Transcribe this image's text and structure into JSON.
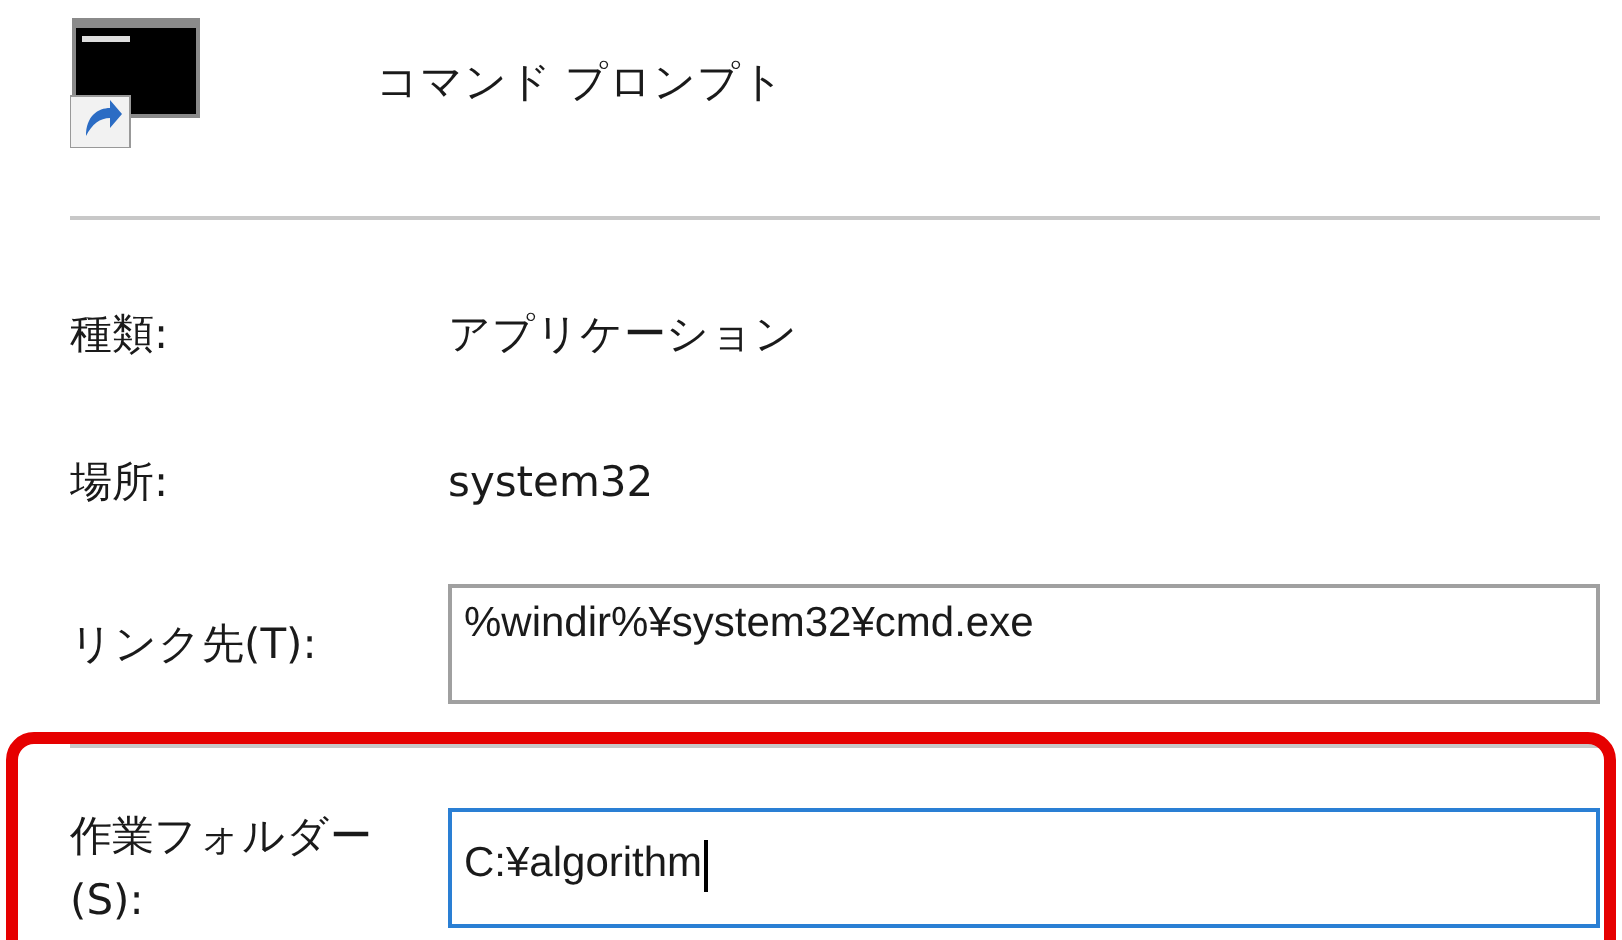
{
  "header": {
    "title": "コマンド プロンプト"
  },
  "info_rows": [
    {
      "label": "種類:",
      "value": "アプリケーション"
    },
    {
      "label": "場所:",
      "value": "system32"
    }
  ],
  "target": {
    "label": "リンク先(T):",
    "value": "%windir%¥system32¥cmd.exe",
    "focused": false
  },
  "working_folder": {
    "label_lines": [
      "作業フォルダー",
      "(S):"
    ],
    "value": "C:¥algorithm",
    "focused": true,
    "highlighted": true
  }
}
